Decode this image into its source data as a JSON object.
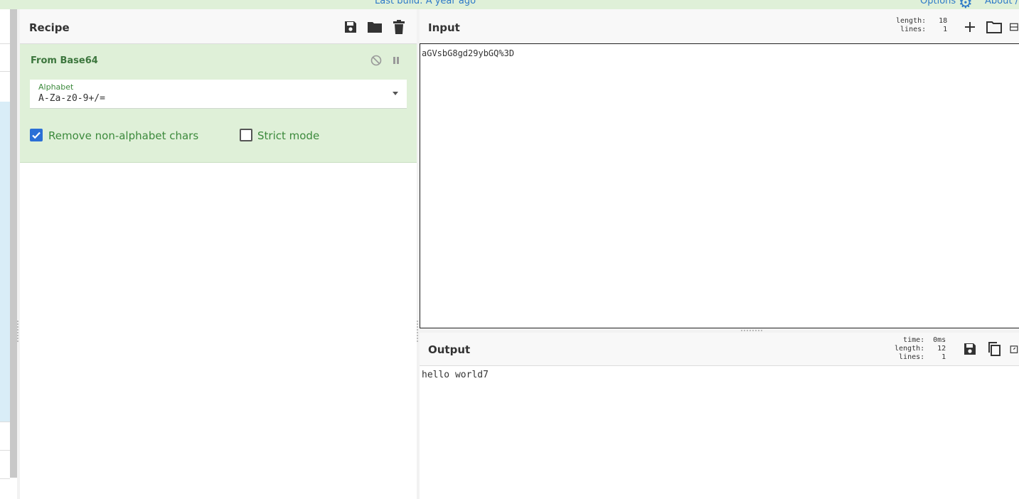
{
  "banner": {
    "last_build": "Last build: A year ago",
    "options_label": "Options",
    "about_label": "About /"
  },
  "recipe": {
    "title": "Recipe",
    "operation": {
      "name": "From Base64",
      "alphabet_label": "Alphabet",
      "alphabet_value": "A-Za-z0-9+/=",
      "remove_non_alphabet": {
        "label": "Remove non-alphabet chars",
        "checked": true
      },
      "strict_mode": {
        "label": "Strict mode",
        "checked": false
      }
    }
  },
  "input": {
    "title": "Input",
    "text": "aGVsbG8gd29ybGQ%3D",
    "stats": {
      "length_key": "length:",
      "length": "18",
      "lines_key": "lines:",
      "lines": "1"
    }
  },
  "output": {
    "title": "Output",
    "text": "hello world7",
    "stats": {
      "time_key": "time:",
      "time": "0ms",
      "length_key": "length:",
      "length": "12",
      "lines_key": "lines:",
      "lines": "1"
    }
  },
  "colors": {
    "accent_green": "#3c763d",
    "card_green": "#dff0d8",
    "checkbox_blue": "#2b6fd6",
    "link_blue": "#2f7ac8"
  }
}
